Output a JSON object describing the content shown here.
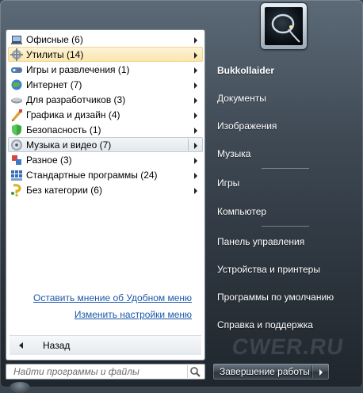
{
  "user": {
    "name": "Bukkollaider"
  },
  "programs": [
    {
      "label": "Офисные (6)",
      "icon": "office-icon",
      "state": "normal"
    },
    {
      "label": "Утилиты (14)",
      "icon": "utilities-icon",
      "state": "selected"
    },
    {
      "label": "Игры и развлечения (1)",
      "icon": "gamepad-icon",
      "state": "normal"
    },
    {
      "label": "Интернет (7)",
      "icon": "internet-icon",
      "state": "normal"
    },
    {
      "label": "Для разработчиков (3)",
      "icon": "developer-icon",
      "state": "normal"
    },
    {
      "label": "Графика и дизайн (4)",
      "icon": "graphics-icon",
      "state": "normal"
    },
    {
      "label": "Безопасность (1)",
      "icon": "shield-icon",
      "state": "normal"
    },
    {
      "label": "Музыка и видео (7)",
      "icon": "music-video-icon",
      "state": "hover"
    },
    {
      "label": "Разное (3)",
      "icon": "misc-icon",
      "state": "normal"
    },
    {
      "label": "Стандартные программы (24)",
      "icon": "standard-programs-icon",
      "state": "normal"
    },
    {
      "label": "Без категории (6)",
      "icon": "uncategorized-icon",
      "state": "normal"
    }
  ],
  "links": {
    "feedback": "Оставить мнение об Удобном меню",
    "settings": "Изменить настройки меню"
  },
  "back_label": "Назад",
  "search": {
    "placeholder": "Найти программы и файлы"
  },
  "right_items": [
    "Bukkollaider",
    "Документы",
    "Изображения",
    "Музыка",
    "Игры",
    "Компьютер",
    "Панель управления",
    "Устройства и принтеры",
    "Программы по умолчанию",
    "Справка и поддержка"
  ],
  "shutdown_label": "Завершение работы",
  "watermark": "CWER.RU",
  "colors": {
    "selected_bg": "#fbe6ad",
    "link": "#1c58a8",
    "frame": "#3f4a55"
  }
}
